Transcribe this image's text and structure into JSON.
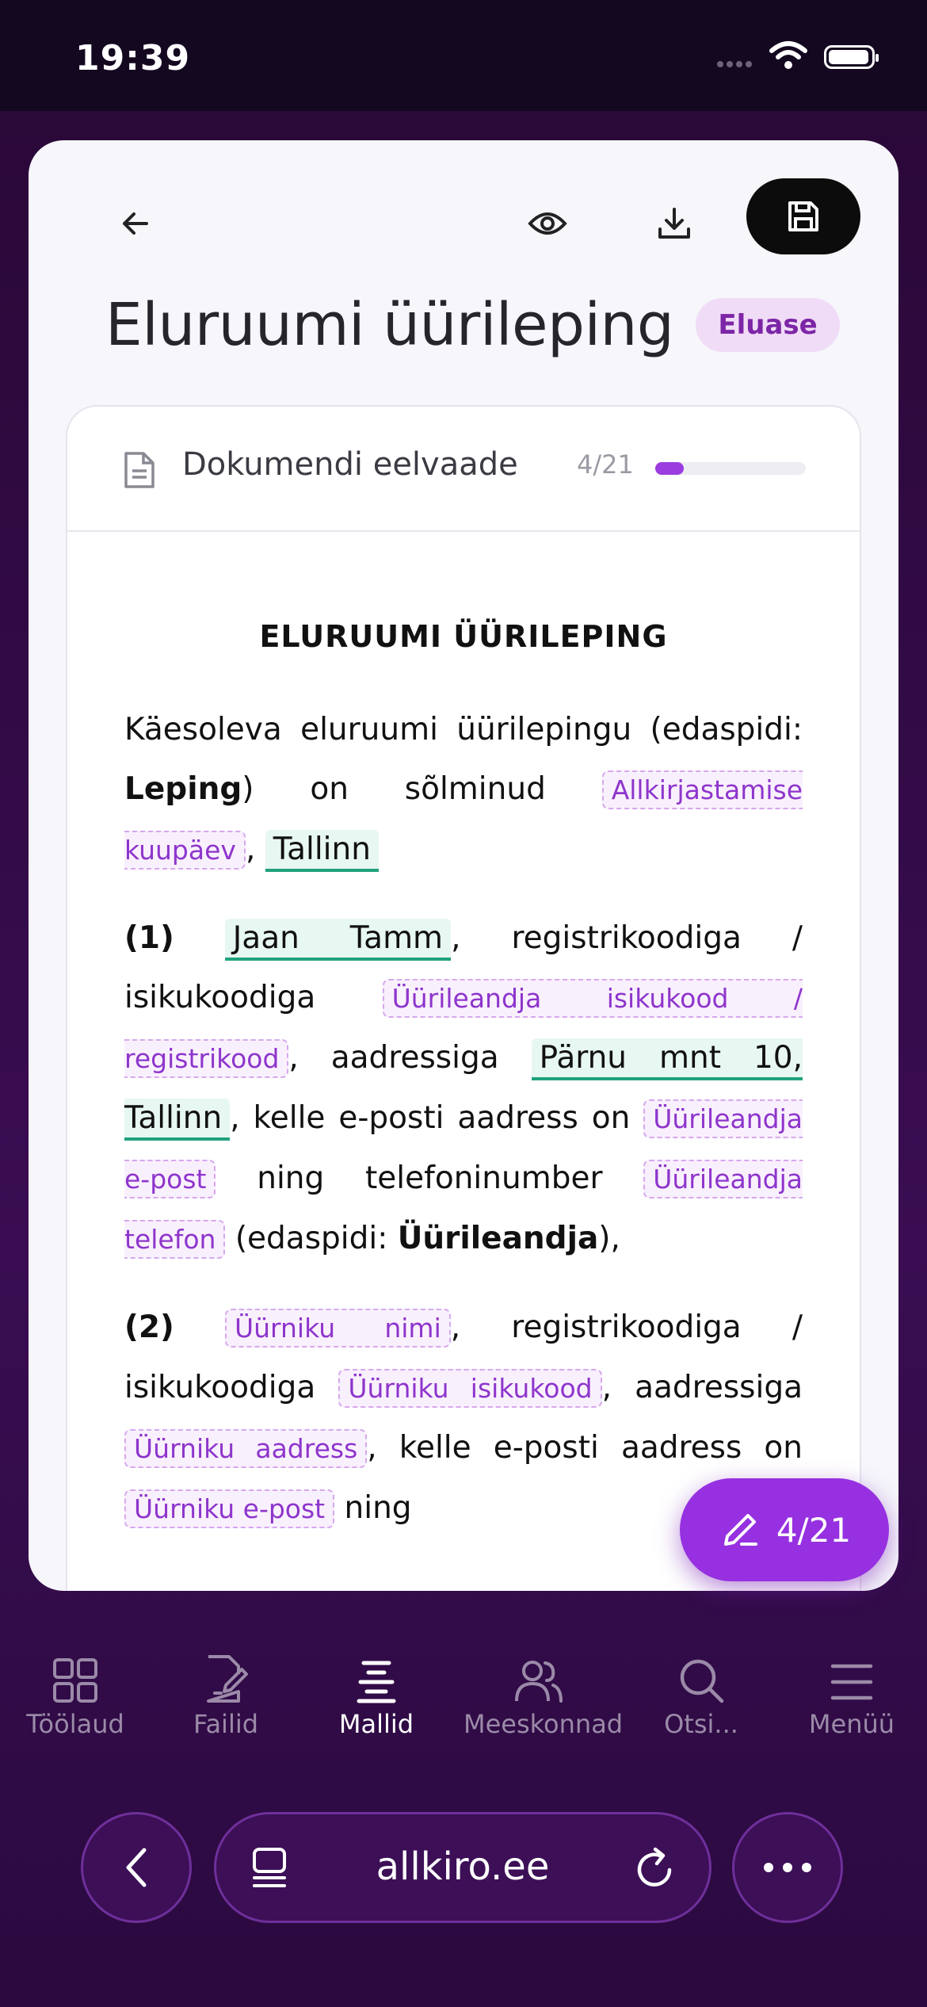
{
  "status": {
    "time": "19:39"
  },
  "header": {
    "title": "Eluruumi üürileping",
    "category": "Eluase"
  },
  "preview": {
    "title": "Dokumendi eelvaade",
    "counter": "4/21",
    "progress": 0.19
  },
  "document": {
    "heading": "ELURUUMI ÜÜRILEPING",
    "p1_a": "Käesoleva eluruumi üürilepingu (edaspidi: ",
    "p1_bold": "Leping",
    "p1_b": ") on sõlminud ",
    "p1_ph_date": "Allkirjastamise kuupäev",
    "p1_c": ", ",
    "p1_city": "Tallinn",
    "p2_num": "(1)",
    "p2_name": "Jaan Tamm",
    "p2_a": ", registrikoodiga / isikukoodiga ",
    "p2_ph_code": "Üürileandja isikukood / registrikood",
    "p2_b": ", aadressiga ",
    "p2_address": "Pärnu mnt 10, Tallinn",
    "p2_c": ", kelle e-posti aadress on ",
    "p2_ph_email": "Üürileandja e-post",
    "p2_d": " ning telefoninumber ",
    "p2_ph_phone": "Üürileandja telefon",
    "p2_e": " (edaspidi: ",
    "p2_bold": "Üürileandja",
    "p2_f": "),",
    "p3_num": "(2)",
    "p3_ph_name": "Üürniku nimi",
    "p3_a": ", registrikoodiga / isikukoodiga ",
    "p3_ph_code": "Üürniku isikukood",
    "p3_b": ", aadressiga ",
    "p3_ph_address": "Üürniku aadress",
    "p3_c": ", kelle e-posti aadress on ",
    "p3_ph_email": "Üürniku e-post",
    "p3_d": " ning"
  },
  "fab": {
    "label": "4/21"
  },
  "tabbar": {
    "items": [
      {
        "label": "Töölaud",
        "icon": "grid-icon"
      },
      {
        "label": "Failid",
        "icon": "file-edit-icon"
      },
      {
        "label": "Mallid",
        "icon": "templates-icon"
      },
      {
        "label": "Meeskonnad",
        "icon": "users-icon"
      },
      {
        "label": "Otsi...",
        "icon": "search-icon"
      },
      {
        "label": "Menüü",
        "icon": "menu-icon"
      }
    ]
  },
  "browser": {
    "url": "allkiro.ee"
  }
}
